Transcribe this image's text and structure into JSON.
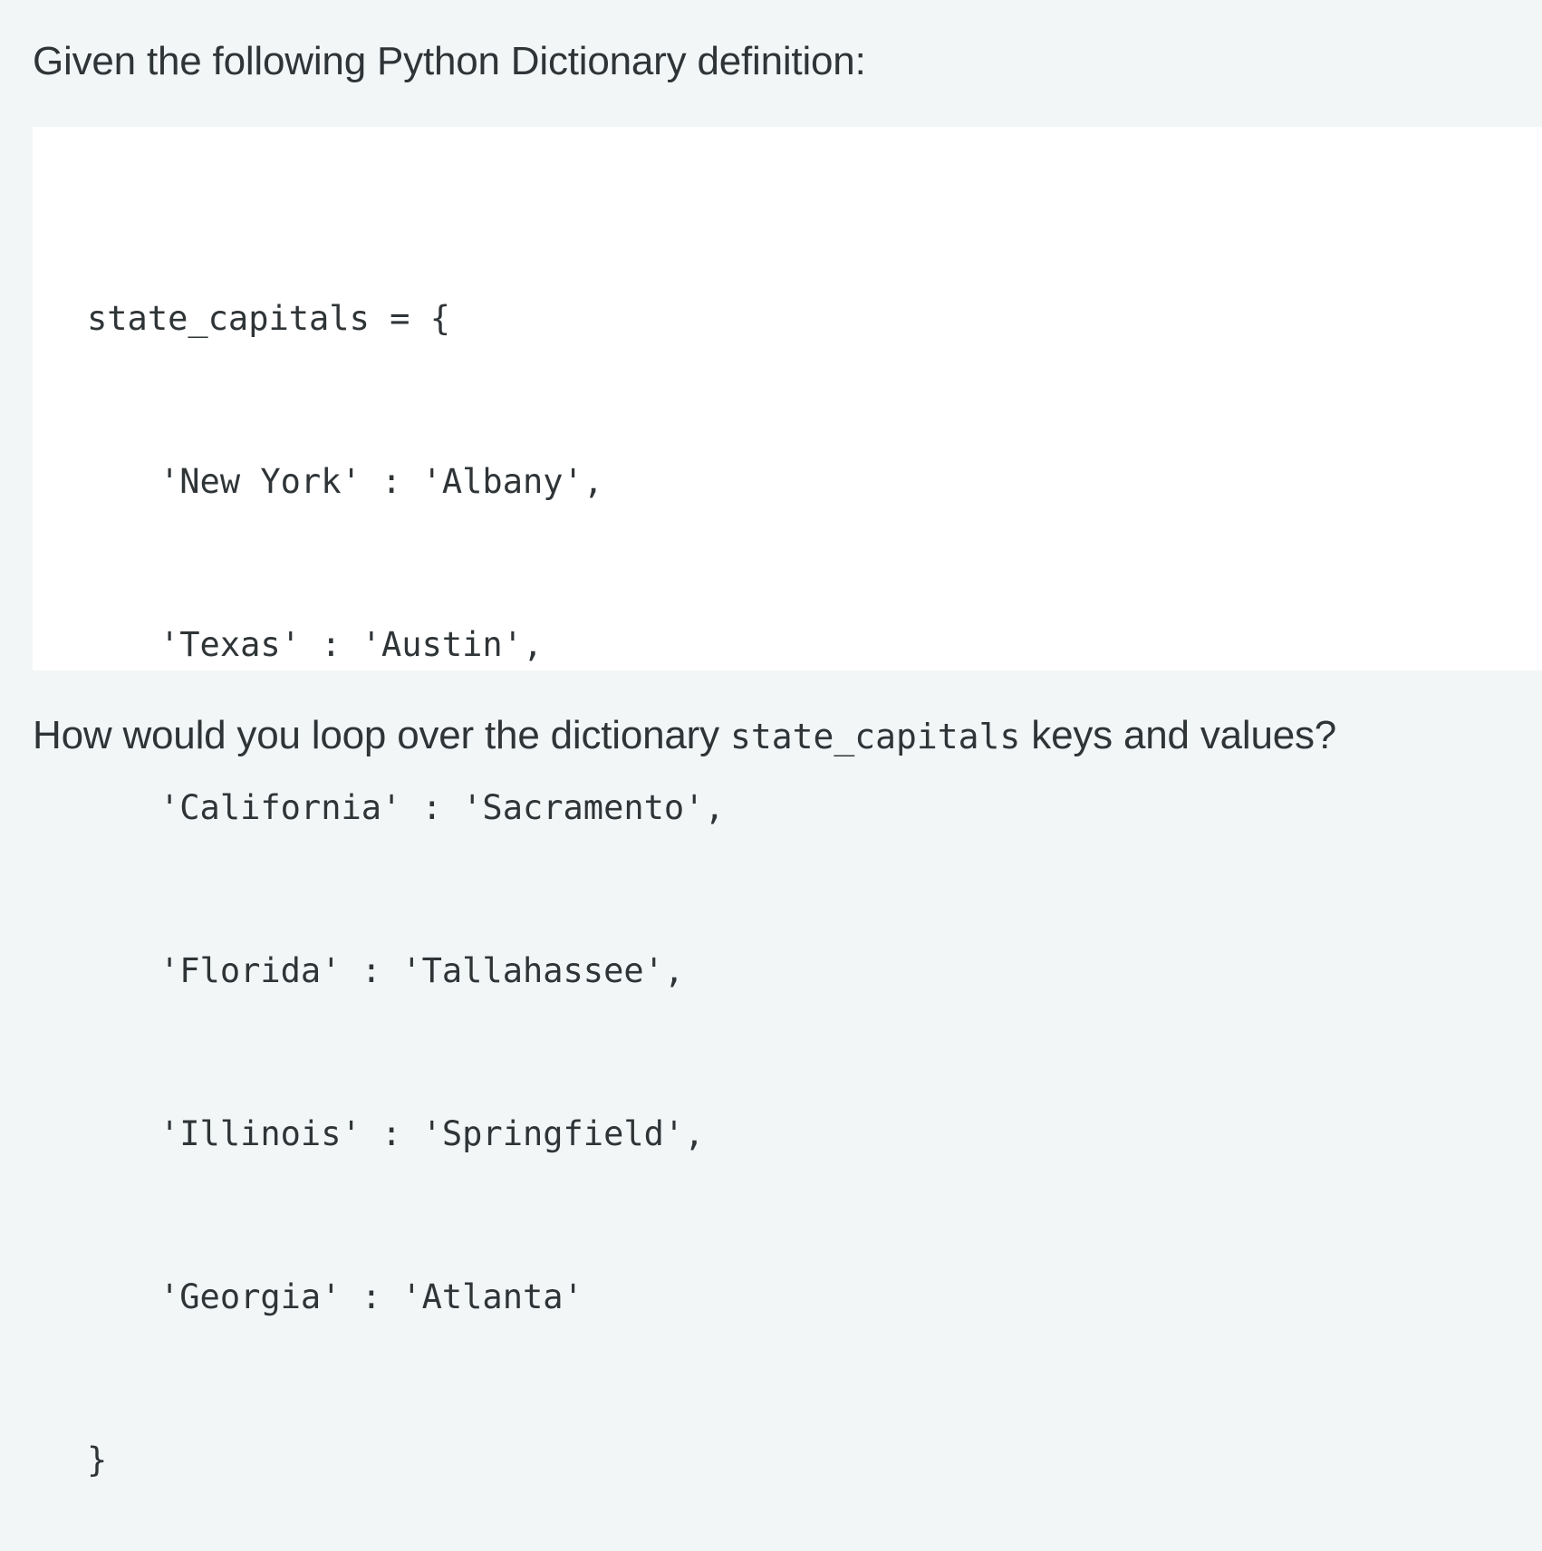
{
  "intro": {
    "text": "Given the following Python Dictionary definition:"
  },
  "code": {
    "lines": [
      {
        "text": "state_capitals = {",
        "indent": false
      },
      {
        "text": "'New York' : 'Albany',",
        "indent": true
      },
      {
        "text": "'Texas' : 'Austin',",
        "indent": true
      },
      {
        "text": "'California' : 'Sacramento',",
        "indent": true
      },
      {
        "text": "'Florida' : 'Tallahassee',",
        "indent": true
      },
      {
        "text": "'Illinois' : 'Springfield',",
        "indent": true
      },
      {
        "text": "'Georgia' : 'Atlanta'",
        "indent": true
      },
      {
        "text": "}",
        "indent": false
      }
    ]
  },
  "question": {
    "prefix": "How would you loop over the dictionary ",
    "code": "state_capitals",
    "suffix": " keys and values?"
  }
}
